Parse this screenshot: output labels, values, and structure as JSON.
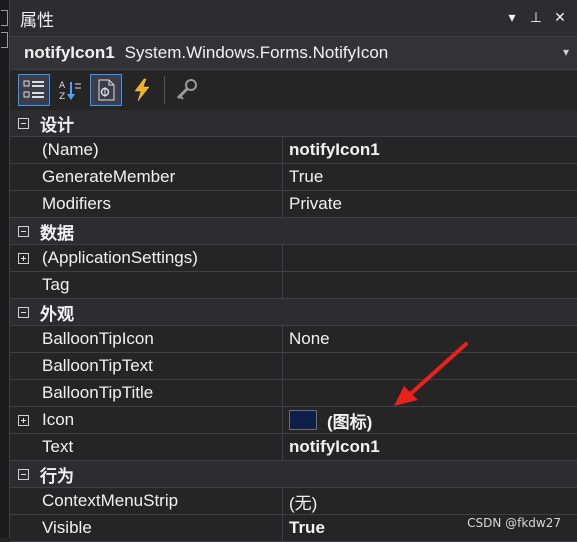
{
  "panel": {
    "title": "属性"
  },
  "title_buttons": {
    "dropdown_glyph": "▾",
    "pin_glyph": "⊥",
    "close_glyph": "✕"
  },
  "object_selector": {
    "name": "notifyIcon1",
    "type": "System.Windows.Forms.NotifyIcon",
    "dropdown_glyph": "▾"
  },
  "toolbar": {
    "tools": [
      {
        "name": "categorized-icon",
        "active": true
      },
      {
        "name": "alphabetical-icon",
        "active": false
      },
      {
        "name": "properties-icon",
        "active": true
      },
      {
        "name": "events-icon",
        "active": false
      },
      {
        "name": "property-pages-icon",
        "active": false
      }
    ]
  },
  "grid": {
    "categories": [
      {
        "label": "设计",
        "properties": [
          {
            "name": "(Name)",
            "value": "notifyIcon1",
            "bold": true
          },
          {
            "name": "GenerateMember",
            "value": "True",
            "bold": false
          },
          {
            "name": "Modifiers",
            "value": "Private",
            "bold": false
          }
        ]
      },
      {
        "label": "数据",
        "properties": [
          {
            "name": "(ApplicationSettings)",
            "value": "",
            "bold": false,
            "expandable": true
          },
          {
            "name": "Tag",
            "value": "",
            "bold": false
          }
        ]
      },
      {
        "label": "外观",
        "properties": [
          {
            "name": "BalloonTipIcon",
            "value": "None",
            "bold": false
          },
          {
            "name": "BalloonTipText",
            "value": "",
            "bold": false
          },
          {
            "name": "BalloonTipTitle",
            "value": "",
            "bold": false
          },
          {
            "name": "Icon",
            "value": "(图标)",
            "bold": true,
            "expandable": true,
            "swatch": true
          },
          {
            "name": "Text",
            "value": "notifyIcon1",
            "bold": true
          }
        ]
      },
      {
        "label": "行为",
        "properties": [
          {
            "name": "ContextMenuStrip",
            "value": "(无)",
            "bold": false
          },
          {
            "name": "Visible",
            "value": "True",
            "bold": true
          }
        ]
      }
    ]
  },
  "watermark": "CSDN @fkdw27",
  "colors": {
    "background": "#252526",
    "border": "#3f3f46",
    "accent": "#3399ff",
    "arrow": "#e8221b"
  }
}
